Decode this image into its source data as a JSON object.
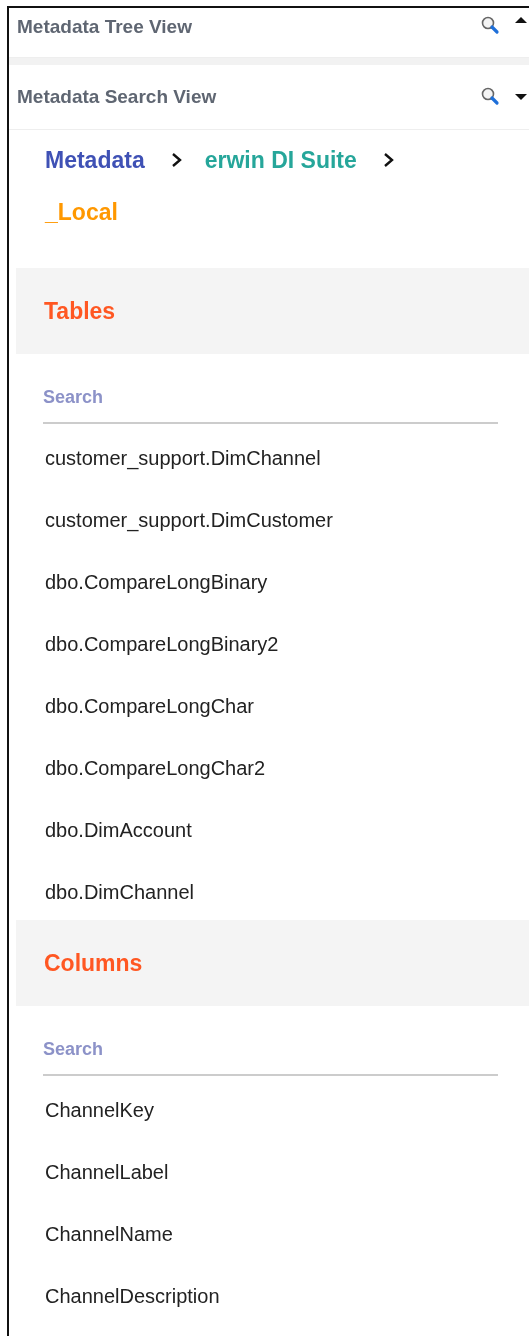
{
  "panels": [
    {
      "title": "Metadata Tree View",
      "expanded": false
    },
    {
      "title": "Metadata Search View",
      "expanded": true
    }
  ],
  "breadcrumb": [
    {
      "label": "Metadata",
      "color": "#3f51b5"
    },
    {
      "label": "erwin DI Suite",
      "color": "#26a69a"
    },
    {
      "label": "_Local",
      "color": "#ff9800"
    }
  ],
  "sections": [
    {
      "title": "Tables",
      "search": {
        "placeholder": "Search"
      },
      "items": [
        "customer_support.DimChannel",
        "customer_support.DimCustomer",
        "dbo.CompareLongBinary",
        "dbo.CompareLongBinary2",
        "dbo.CompareLongChar",
        "dbo.CompareLongChar2",
        "dbo.DimAccount",
        "dbo.DimChannel"
      ]
    },
    {
      "title": "Columns",
      "search": {
        "placeholder": "Search"
      },
      "items": [
        "ChannelKey",
        "ChannelLabel",
        "ChannelName",
        "ChannelDescription"
      ]
    }
  ]
}
